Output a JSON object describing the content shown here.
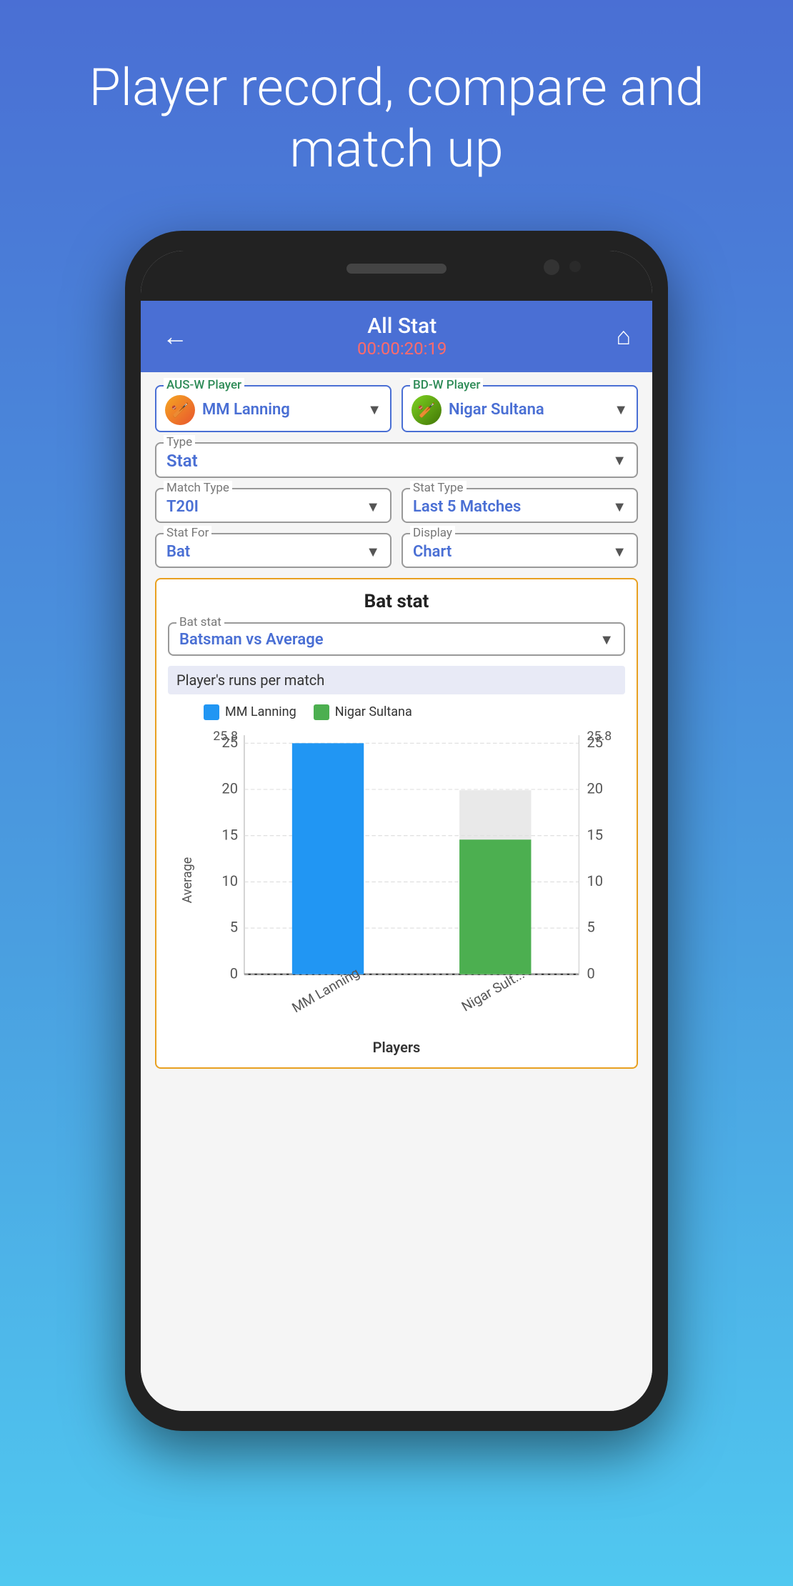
{
  "hero": {
    "title": "Player record, compare and match up"
  },
  "header": {
    "back_icon": "←",
    "title": "All Stat",
    "subtitle": "00:00:20:19",
    "home_icon": "⌂"
  },
  "players": {
    "aus_label": "AUS-W Player",
    "aus_name": "MM Lanning",
    "bd_label": "BD-W Player",
    "bd_name": "Nigar Sultana"
  },
  "type_selector": {
    "label": "Type",
    "value": "Stat"
  },
  "match_type": {
    "label": "Match Type",
    "value": "T20I"
  },
  "stat_type": {
    "label": "Stat Type",
    "value": "Last 5 Matches"
  },
  "stat_for": {
    "label": "Stat For",
    "value": "Bat"
  },
  "display": {
    "label": "Display",
    "value": "Chart"
  },
  "chart_card": {
    "title": "Bat stat",
    "bat_stat_label": "Bat stat",
    "bat_stat_value": "Batsman vs Average",
    "subtitle": "Player's runs per match",
    "legend": [
      {
        "name": "MM Lanning",
        "color": "blue"
      },
      {
        "name": "Nigar Sultana",
        "color": "green"
      }
    ],
    "y_axis_label": "Average",
    "x_axis_label": "Players",
    "bars": [
      {
        "player": "MM Lanning",
        "value": 25.8,
        "color": "#2196f3"
      },
      {
        "player": "Nigar Sult...",
        "value": 15,
        "color": "#4caf50"
      }
    ],
    "y_ticks": [
      0,
      5,
      10,
      15,
      20,
      25
    ],
    "y_max_left": "25.8",
    "y_max_right": "25.8",
    "y_second_left": "25",
    "y_second_right": "25"
  }
}
